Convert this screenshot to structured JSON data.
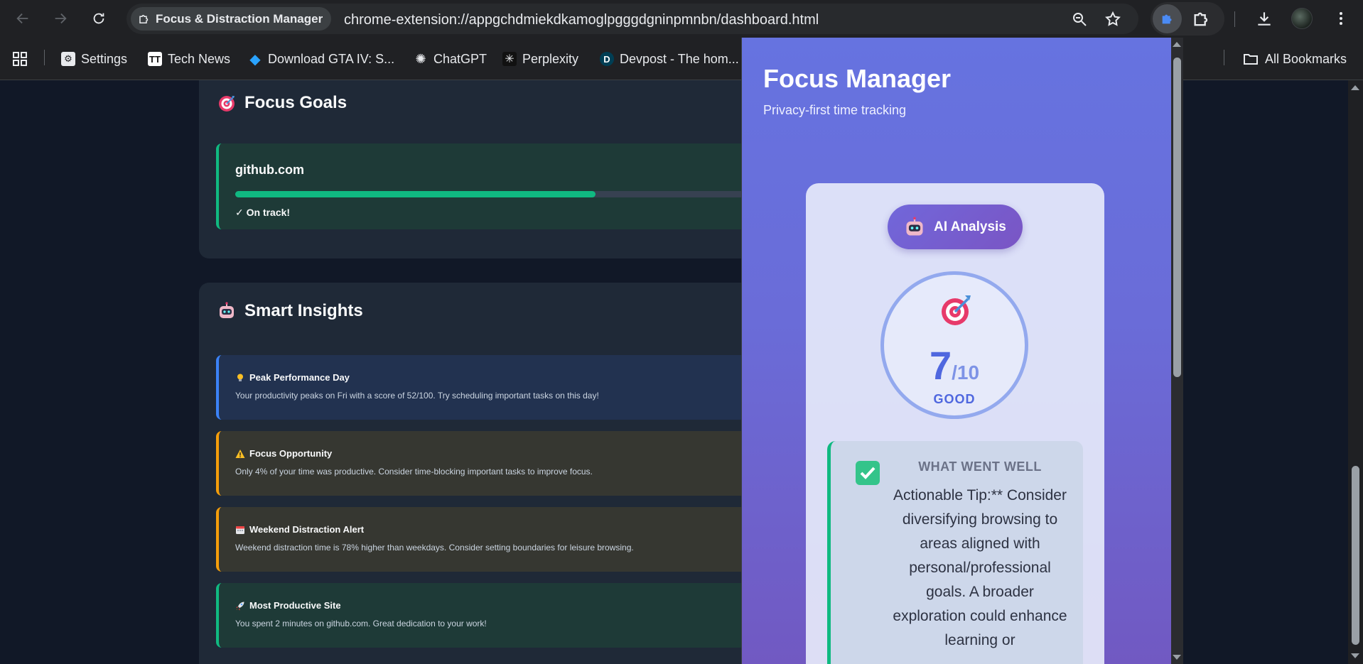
{
  "browser": {
    "tab_chip_label": "Focus & Distraction Manager",
    "url": "chrome-extension://appgchdmiekdkamoglpgggdgninpmnbn/dashboard.html"
  },
  "bookmarks": {
    "items": [
      {
        "label": "Settings",
        "icon": "settings-favicon"
      },
      {
        "label": "Tech News",
        "icon": "tech-news-favicon"
      },
      {
        "label": "Download GTA IV: S...",
        "icon": "gta-favicon"
      },
      {
        "label": "ChatGPT",
        "icon": "chatgpt-favicon"
      },
      {
        "label": "Perplexity",
        "icon": "perplexity-favicon"
      },
      {
        "label": "Devpost - The hom...",
        "icon": "devpost-favicon"
      }
    ],
    "all_bookmarks_label": "All Bookmarks"
  },
  "dashboard": {
    "focus_goals": {
      "title": "Focus Goals",
      "goals": [
        {
          "site": "github.com",
          "status": "✓ On track!",
          "progress_percent": 65
        }
      ]
    },
    "smart_insights": {
      "title": "Smart Insights",
      "items": [
        {
          "title": "Peak Performance Day",
          "icon": "lightbulb-icon",
          "description": "Your productivity peaks on Fri with a score of 52/100. Try scheduling important tasks on this day!",
          "accent": "#3b82f6",
          "background": "#223250"
        },
        {
          "title": "Focus Opportunity",
          "icon": "warning-icon",
          "description": "Only 4% of your time was productive. Consider time-blocking important tasks to improve focus.",
          "accent": "#f59e0b",
          "background": "#363731"
        },
        {
          "title": "Weekend Distraction Alert",
          "icon": "calendar-icon",
          "description": "Weekend distraction time is 78% higher than weekdays. Consider setting boundaries for leisure browsing.",
          "accent": "#f59e0b",
          "background": "#363731"
        },
        {
          "title": "Most Productive Site",
          "icon": "rocket-icon",
          "description": "You spent 2 minutes on github.com. Great dedication to your work!",
          "accent": "#10b981",
          "background": "#1e3a37"
        }
      ]
    }
  },
  "popup": {
    "title": "Focus Manager",
    "subtitle": "Privacy-first time tracking",
    "ai_button_label": "AI Analysis",
    "score": {
      "value": "7",
      "out_of": "/10",
      "label": "GOOD"
    },
    "went_well": {
      "heading": "WHAT WENT WELL",
      "text": "Actionable Tip:** Consider diversifying browsing to areas aligned with personal/professional goals. A broader exploration could enhance learning or"
    }
  },
  "colors": {
    "accent_blue": "#4f67df",
    "success_green": "#10b981",
    "warning_amber": "#f59e0b",
    "info_blue": "#3b82f6"
  }
}
